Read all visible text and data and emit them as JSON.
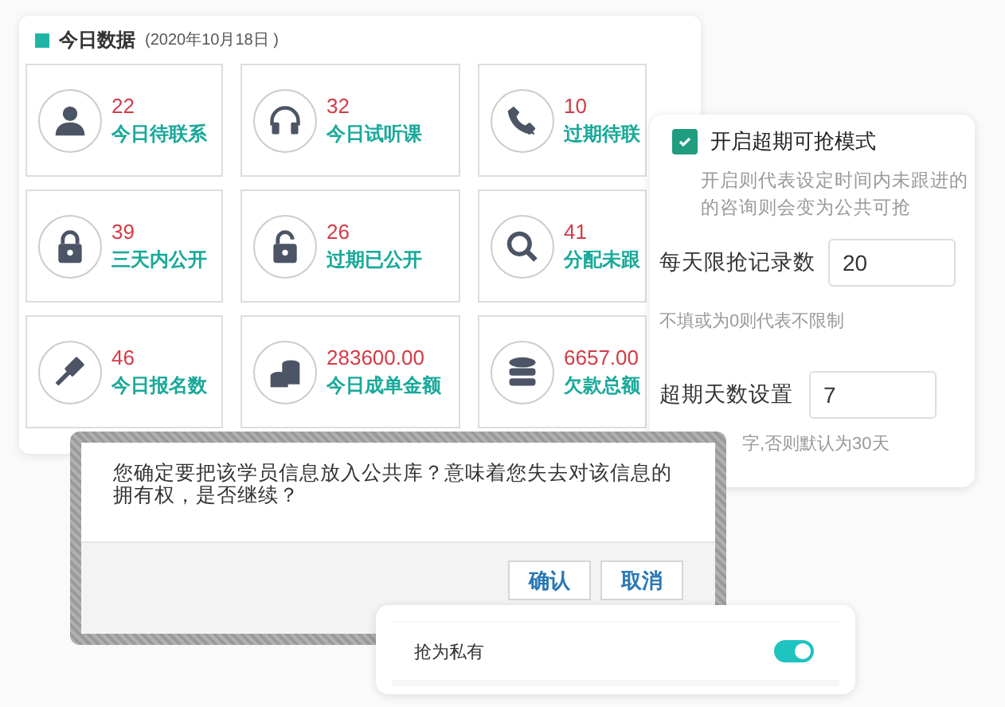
{
  "header": {
    "title": "今日数据",
    "date": "(2020年10月18日 )"
  },
  "stats": [
    {
      "kind": "person",
      "value": "22",
      "label": "今日待联系"
    },
    {
      "kind": "headphones",
      "value": "32",
      "label": "今日试听课"
    },
    {
      "kind": "phone",
      "value": "10",
      "label": "过期待联"
    },
    {
      "kind": "lock",
      "value": "39",
      "label": "三天内公开"
    },
    {
      "kind": "unlock",
      "value": "26",
      "label": "过期已公开"
    },
    {
      "kind": "search",
      "value": "41",
      "label": "分配未跟"
    },
    {
      "kind": "gavel",
      "value": "46",
      "label": "今日报名数"
    },
    {
      "kind": "coins",
      "value": "283600.00",
      "label": "今日成单金额"
    },
    {
      "kind": "database",
      "value": "6657.00",
      "label": "欠款总额"
    }
  ],
  "settings": {
    "enabled": true,
    "enable_label": "开启超期可抢模式",
    "enable_hint": "开启则代表设定时间内未跟进的的咨询则会变为公共可抢",
    "daily_limit": {
      "label": "每天限抢记录数",
      "value": "20",
      "hint": "不填或为0则代表不限制"
    },
    "overdue_days": {
      "label": "超期天数设置",
      "value": "7",
      "hint": "字,否则默认为30天"
    }
  },
  "dialog": {
    "message": "您确定要把该学员信息放入公共库？意味着您失去对该信息的拥有权，是否继续？",
    "buttons": [
      "确认",
      "取消"
    ]
  },
  "private_toggle": {
    "label": "抢为私有",
    "on": true
  }
}
